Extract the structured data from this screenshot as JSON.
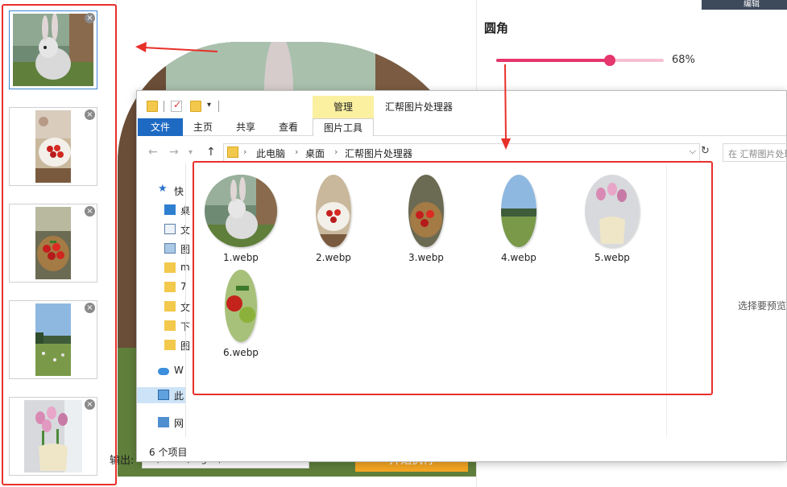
{
  "app": {
    "settings_title": "圆角",
    "slider_value": "68%",
    "slider_fraction": 0.68,
    "output_label": "输出:",
    "output_path": "C:/Users/ragoo/Deskto",
    "run_button": "开始执行",
    "corner_button": "编辑",
    "accent_color": "#e5366d",
    "annotation_color": "#e8302a",
    "thumbnails": [
      {
        "name": "rabbit",
        "remove_icon": "close-icon"
      },
      {
        "name": "strawberries-plate",
        "remove_icon": "close-icon"
      },
      {
        "name": "strawberries-basket",
        "remove_icon": "close-icon"
      },
      {
        "name": "meadow",
        "remove_icon": "close-icon"
      },
      {
        "name": "tulips-vase",
        "remove_icon": "close-icon"
      }
    ],
    "thumb_remove_glyph": "×"
  },
  "explorer": {
    "manage_tab": "管理",
    "window_title": "汇帮图片处理器",
    "tabs": {
      "file": "文件",
      "home": "主页",
      "share": "共享",
      "view": "查看",
      "picture_tools": "图片工具"
    },
    "breadcrumb": [
      "此电脑",
      "桌面",
      "汇帮图片处理器"
    ],
    "search_placeholder": "在 汇帮图片处理器 中搜索",
    "nav_items": [
      "快",
      "桌",
      "文",
      "图",
      "m",
      "7",
      "文",
      "下",
      "图",
      "W",
      "此",
      "网"
    ],
    "files": [
      "1.webp",
      "2.webp",
      "3.webp",
      "4.webp",
      "5.webp",
      "6.webp"
    ],
    "preview_hint": "选择要预览的文件。",
    "status": "6 个项目"
  }
}
